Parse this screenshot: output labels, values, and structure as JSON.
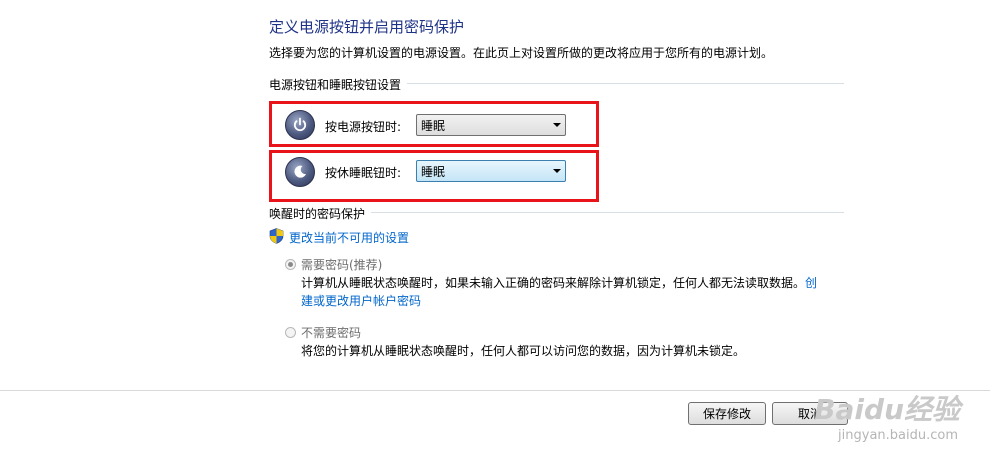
{
  "page": {
    "title": "定义电源按钮并启用密码保护",
    "description": "选择要为您的计算机设置的电源设置。在此页上对设置所做的更改将应用于您所有的电源计划。"
  },
  "power_group": {
    "label": "电源按钮和睡眠按钮设置",
    "power_button": {
      "label": "按电源按钮时:",
      "value": "睡眠",
      "icon": "power-icon"
    },
    "sleep_button": {
      "label": "按休睡眠钮时:",
      "value": "睡眠",
      "icon": "sleep-icon"
    }
  },
  "wake_group": {
    "label": "唤醒时的密码保护",
    "change_link": "更改当前不可用的设置",
    "options": [
      {
        "label": "需要密码(推荐)",
        "selected": true,
        "description": "计算机从睡眠状态唤醒时，如果未输入正确的密码来解除计算机锁定，任何人都无法读取数据。",
        "link_part1": "创",
        "link_part2": "建或更改用户帐户密码"
      },
      {
        "label": "不需要密码",
        "selected": false,
        "description": "将您的计算机从睡眠状态唤醒时，任何人都可以访问您的数据，因为计算机未锁定。"
      }
    ]
  },
  "footer": {
    "save_label": "保存修改",
    "cancel_label": "取消"
  },
  "watermark": {
    "brand": "Baidu经验",
    "url": "jingyan.baidu.com"
  },
  "colors": {
    "title": "#1e3287",
    "link": "#0066cc",
    "highlight_box": "#e8141a"
  }
}
